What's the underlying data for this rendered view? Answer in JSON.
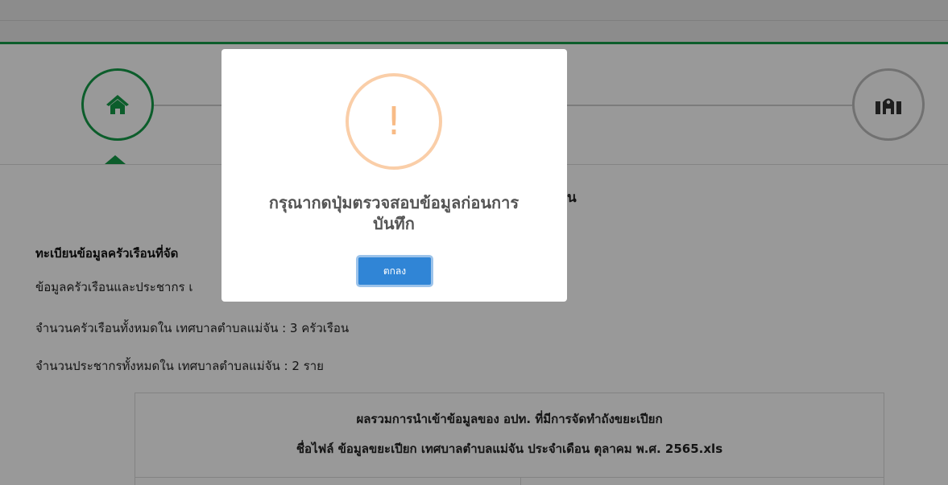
{
  "icons": {
    "home": "home-icon",
    "office": "government-building-icon",
    "warning": "warning-exclamation-icon"
  },
  "colors": {
    "accent_green": "#149c48",
    "confirm_blue": "#3085d6",
    "warning_orange": "#f8bb86"
  },
  "content": {
    "section_title_visible_tail": "น",
    "registry_heading": "ทะเบียนข้อมูลครัวเรือนที่จัด",
    "household_population_line": "ข้อมูลครัวเรือนและประชากร เ",
    "total_households_line": "จำนวนครัวเรือนทั้งหมดใน เทศบาลตำบลแม่จัน : 3 ครัวเรือน",
    "total_population_line": "จำนวนประชากรทั้งหมดใน เทศบาลตำบลแม่จัน : 2 ราย",
    "summary_title": "ผลรวมการนำเข้าข้อมูลของ อปท. ที่มีการจัดทำถังขยะเปียก",
    "summary_filename": "ชื่อไฟล์ ข้อมูลขยะเปียก เทศบาลตำบลแม่จัน ประจำเดือน ตุลาคม พ.ศ. 2565.xls"
  },
  "dialog": {
    "icon_glyph": "!",
    "message_line1": "กรุณากดปุ่มตรวจสอบข้อมูลก่อนการ",
    "message_line2": "บันทึก",
    "confirm_label": "ตกลง"
  }
}
